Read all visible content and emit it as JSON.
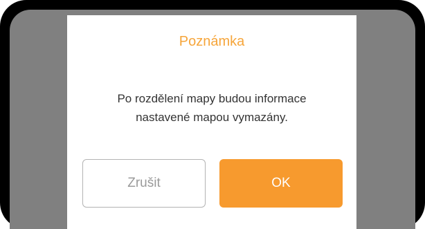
{
  "dialog": {
    "title": "Poznámka",
    "message": "Po rozdělení mapy budou informace\nnastavené mapou vymazány.",
    "cancel_label": "Zrušit",
    "ok_label": "OK"
  },
  "colors": {
    "accent": "#f79a2e",
    "title": "#f6a53a",
    "overlay": "#808080",
    "frame": "#000000"
  }
}
